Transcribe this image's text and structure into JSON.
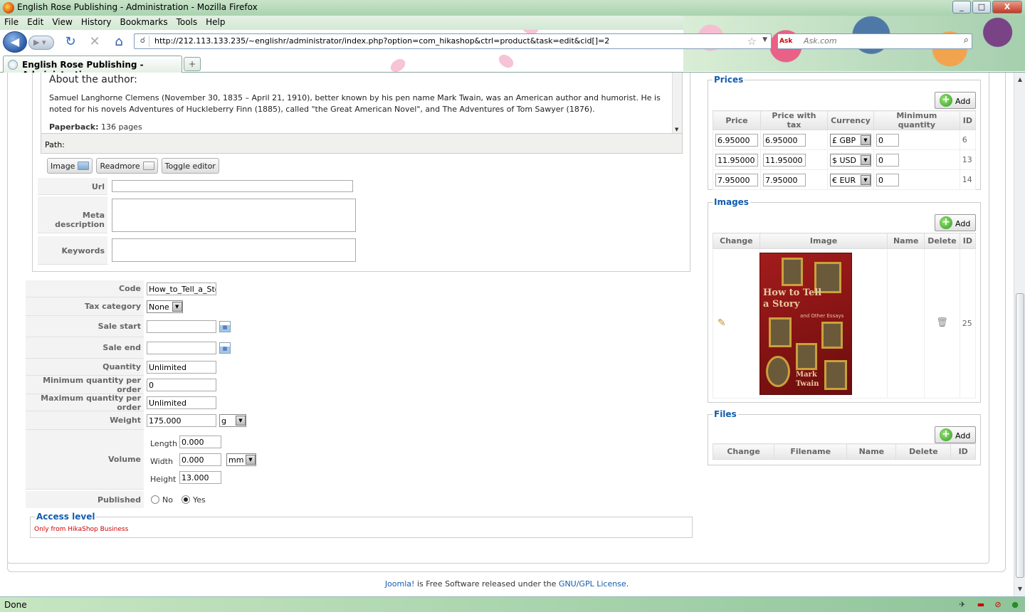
{
  "window": {
    "title": "English Rose Publishing - Administration - Mozilla Firefox",
    "min": "_",
    "max": "□",
    "close": "X"
  },
  "menu": [
    "File",
    "Edit",
    "View",
    "History",
    "Bookmarks",
    "Tools",
    "Help"
  ],
  "nav": {
    "url": "http://212.113.133.235/~englishr/administrator/index.php?option=com_hikashop&ctrl=product&task=edit&cid[]=2",
    "search_engine": "Ask",
    "search_placeholder": "Ask.com"
  },
  "tab": {
    "title": "English Rose Publishing - Administrati...",
    "new": "+"
  },
  "editor": {
    "heading": "About the author:",
    "paragraph": "Samuel Langhorne Clemens (November 30, 1835 – April 21, 1910), better known by his pen name Mark Twain, was an American author and humorist. He is noted for his novels Adventures of Huckleberry Finn (1885), called \"the Great American Novel\", and The Adventures of Tom Sawyer (1876).",
    "paperback_label": "Paperback:",
    "paperback_value": " 136 pages",
    "path_label": "Path:",
    "buttons": [
      "Image",
      "Readmore",
      "Toggle editor"
    ]
  },
  "meta": {
    "url_label": "Url",
    "meta_description_label": "Meta description",
    "keywords_label": "Keywords"
  },
  "product": {
    "code_label": "Code",
    "code_value": "How_to_Tell_a_Story",
    "tax_label": "Tax category",
    "tax_value": "None",
    "sale_start_label": "Sale start",
    "sale_end_label": "Sale end",
    "quantity_label": "Quantity",
    "quantity_value": "Unlimited",
    "min_qty_label": "Minimum quantity per order",
    "min_qty_value": "0",
    "max_qty_label": "Maximum quantity per order",
    "max_qty_value": "Unlimited",
    "weight_label": "Weight",
    "weight_value": "175.000",
    "weight_unit": "g",
    "volume_label": "Volume",
    "length_label": "Length",
    "length_value": "0.000",
    "width_label": "Width",
    "width_value": "0.000",
    "volume_unit": "mm",
    "height_label": "Height",
    "height_value": "13.000",
    "published_label": "Published",
    "published_no": "No",
    "published_yes": "Yes",
    "published_selected": "Yes"
  },
  "access": {
    "legend": "Access level",
    "value": "Only from HikaShop Business"
  },
  "prices": {
    "legend": "Prices",
    "add": "Add",
    "headers": [
      "Price",
      "Price with tax",
      "Currency",
      "Minimum quantity",
      "ID"
    ],
    "rows": [
      {
        "price": "6.95000",
        "with_tax": "6.95000",
        "currency": "£ GBP",
        "min_qty": "0",
        "id": "6"
      },
      {
        "price": "11.95000",
        "with_tax": "11.95000",
        "currency": "$ USD",
        "min_qty": "0",
        "id": "13"
      },
      {
        "price": "7.95000",
        "with_tax": "7.95000",
        "currency": "€ EUR",
        "min_qty": "0",
        "id": "14"
      }
    ]
  },
  "images": {
    "legend": "Images",
    "add": "Add",
    "headers": [
      "Change",
      "Image",
      "Name",
      "Delete",
      "ID"
    ],
    "rows": [
      {
        "id": "25",
        "cover_title": "How to Tell a Story",
        "cover_subtitle": "and Other Essays",
        "cover_author": "Mark Twain"
      }
    ]
  },
  "files": {
    "legend": "Files",
    "add": "Add",
    "headers": [
      "Change",
      "Filename",
      "Name",
      "Delete",
      "ID"
    ]
  },
  "footer": {
    "joomla": "Joomla!",
    "middle": " is Free Software released under the ",
    "license": "GNU/GPL License",
    "end": "."
  },
  "status": {
    "text": "Done"
  }
}
